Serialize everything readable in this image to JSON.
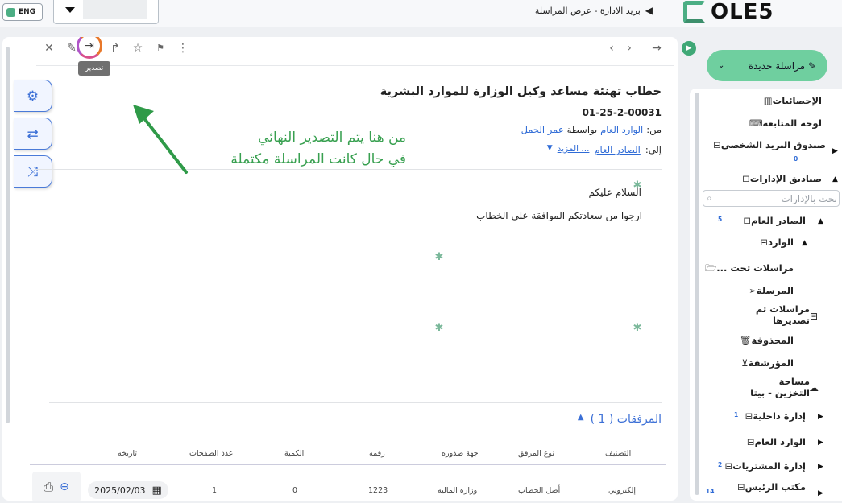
{
  "topbar": {
    "lang_label": "ENG",
    "breadcrumb": "بريد الادارة - عرض المراسلة",
    "logo_text": "OLE5"
  },
  "toolbar": {
    "export_tooltip": "تصدير"
  },
  "letter": {
    "title": "خطاب تهنئة مساعد وكيل الوزارة للموارد البشرية",
    "number": "01-25-2-00031",
    "from_label": "من:",
    "from_dept": "الوارد العام",
    "via_label": "بواسطة",
    "via_person": "عمر الجمل",
    "to_label": "إلى:",
    "to_dept": "الصادر العام",
    "more_label": "... المزيد",
    "greeting": "السلام عليكم",
    "body": "ارجوا من سعادتكم الموافقة على الخطاب"
  },
  "annotation": {
    "line1": "من هنا يتم التصدير النهائي",
    "line2": "في حال كانت المراسلة مكتملة",
    "color": "#38a050"
  },
  "attachments": {
    "title": "المرفقات ( 1 )",
    "headers": [
      "التصنيف",
      "نوع المرفق",
      "جهة صدوره",
      "رقمه",
      "الكمية",
      "عدد الصفحات",
      "تاريخه"
    ],
    "row": {
      "classification": "إلكتروني",
      "type": "أصل الخطاب",
      "issuer": "وزارة المالية",
      "number": "1223",
      "quantity": "0",
      "pages": "1",
      "date": "2025/02/03"
    }
  },
  "sidebar": {
    "new_mail": "مراسلة جديدة",
    "search_placeholder": "بحث بالإدارات",
    "items": [
      {
        "label": "الإحصائيات"
      },
      {
        "label": "لوحة المتابعة"
      },
      {
        "label": "صندوق البريد الشخصي",
        "count": "0"
      },
      {
        "label": "صناديق الإدارات"
      },
      {
        "label": "الصادر العام",
        "count": "5"
      },
      {
        "label": "الوارد"
      },
      {
        "label": "مراسلات تحت ..."
      },
      {
        "label": "المرسلة"
      },
      {
        "label": "مراسلات تم تصديرها"
      },
      {
        "label": "المحذوفة"
      },
      {
        "label": "المؤرشفة"
      },
      {
        "label": "مساحة التخزين - بيتا"
      },
      {
        "label": "إدارة داخلية",
        "count": "1"
      },
      {
        "label": "الوارد العام"
      },
      {
        "label": "إدارة المشتريات",
        "count": "2"
      },
      {
        "label": "مكتب الرئيس",
        "count": "14"
      }
    ]
  },
  "colors": {
    "brand_green": "#4cae84",
    "accent_blue": "#3b6fd6",
    "new_mail_bg": "#6fcf9f"
  }
}
